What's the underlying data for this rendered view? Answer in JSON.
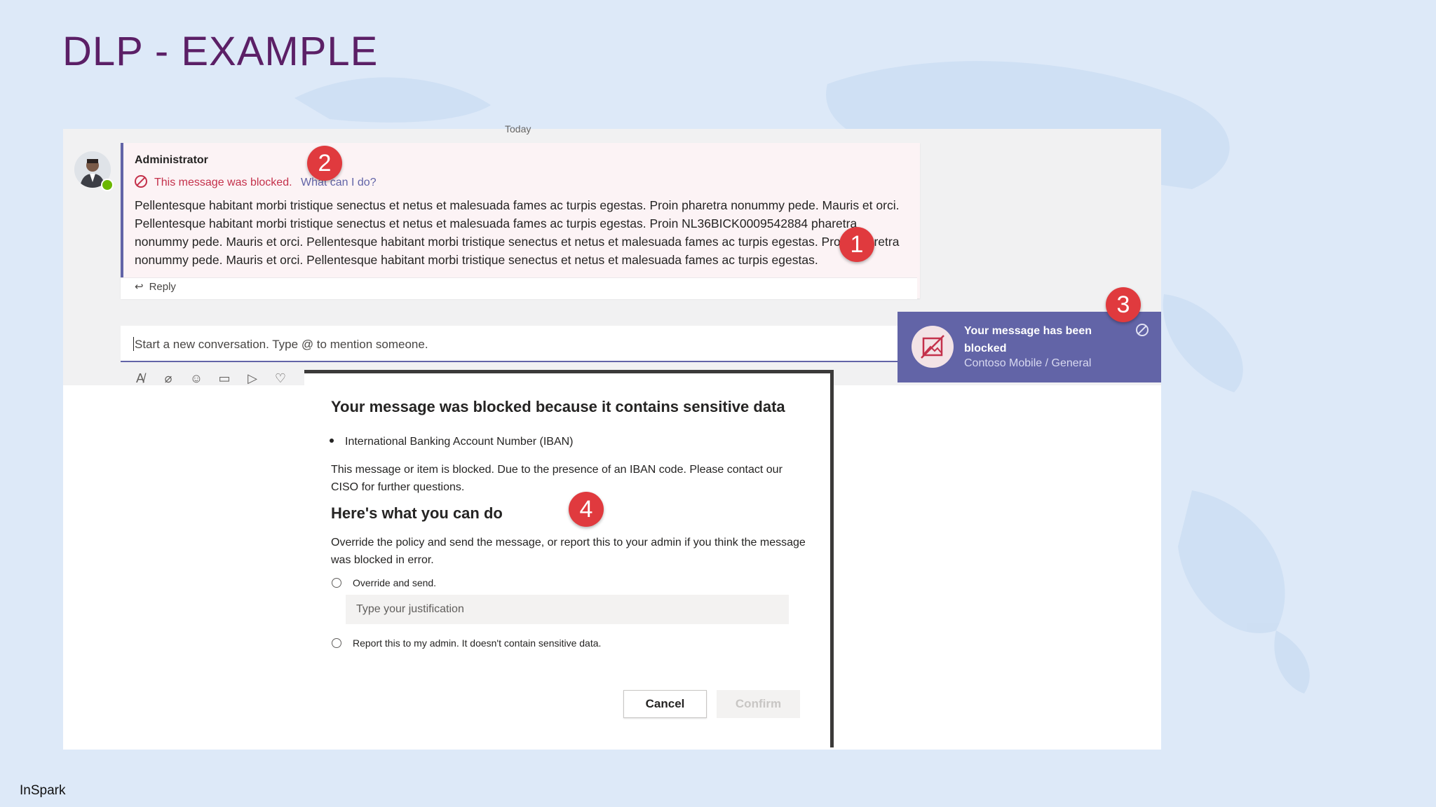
{
  "slide": {
    "title": "DLP - EXAMPLE",
    "brand": "InSpark"
  },
  "colors": {
    "title": "#5b1f66",
    "teams_accent": "#6264a7",
    "blocked_red": "#c4314b",
    "marker_red": "#e03a3e",
    "background": "#dde9f8"
  },
  "chat": {
    "date_divider": "Today",
    "message": {
      "author": "Administrator",
      "blocked_text": "This message was blocked.",
      "help_link": "What can I do?",
      "body": "Pellentesque habitant morbi tristique senectus et netus et malesuada fames ac turpis egestas. Proin pharetra nonummy pede. Mauris et orci. Pellentesque habitant morbi tristique senectus et netus et malesuada fames ac turpis egestas. Proin NL36BICK0009542884 pharetra nonummy pede. Mauris et orci. Pellentesque habitant morbi tristique senectus et netus et malesuada fames ac turpis egestas. Proin pharetra nonummy pede. Mauris et orci. Pellentesque habitant morbi tristique senectus et netus et malesuada fames ac turpis egestas.",
      "reply_label": "Reply"
    },
    "compose": {
      "placeholder": "Start a new conversation. Type @ to mention someone."
    },
    "toolbar_icons": [
      "format-icon",
      "attach-icon",
      "emoji-icon",
      "meet-icon",
      "send-icon",
      "praise-icon"
    ]
  },
  "toast": {
    "title": "Your message has been blocked",
    "subtitle": "Contoso Mobile / General"
  },
  "dialog": {
    "title": "Your message was blocked because it contains sensitive data",
    "sensitive_item": "International Banking Account Number (IBAN)",
    "explanation": "This message or item is blocked. Due to the presence of an IBAN code. Please contact our CISO for further questions.",
    "section_heading": "Here's what you can do",
    "section_text": "Override the policy and send the message, or report this to your admin if you think the message was blocked in error.",
    "option_override": "Override and send.",
    "justification_placeholder": "Type your justification",
    "option_report": "Report this to my admin. It doesn't contain sensitive data.",
    "cancel_label": "Cancel",
    "confirm_label": "Confirm"
  },
  "markers": [
    "1",
    "2",
    "3",
    "4"
  ]
}
